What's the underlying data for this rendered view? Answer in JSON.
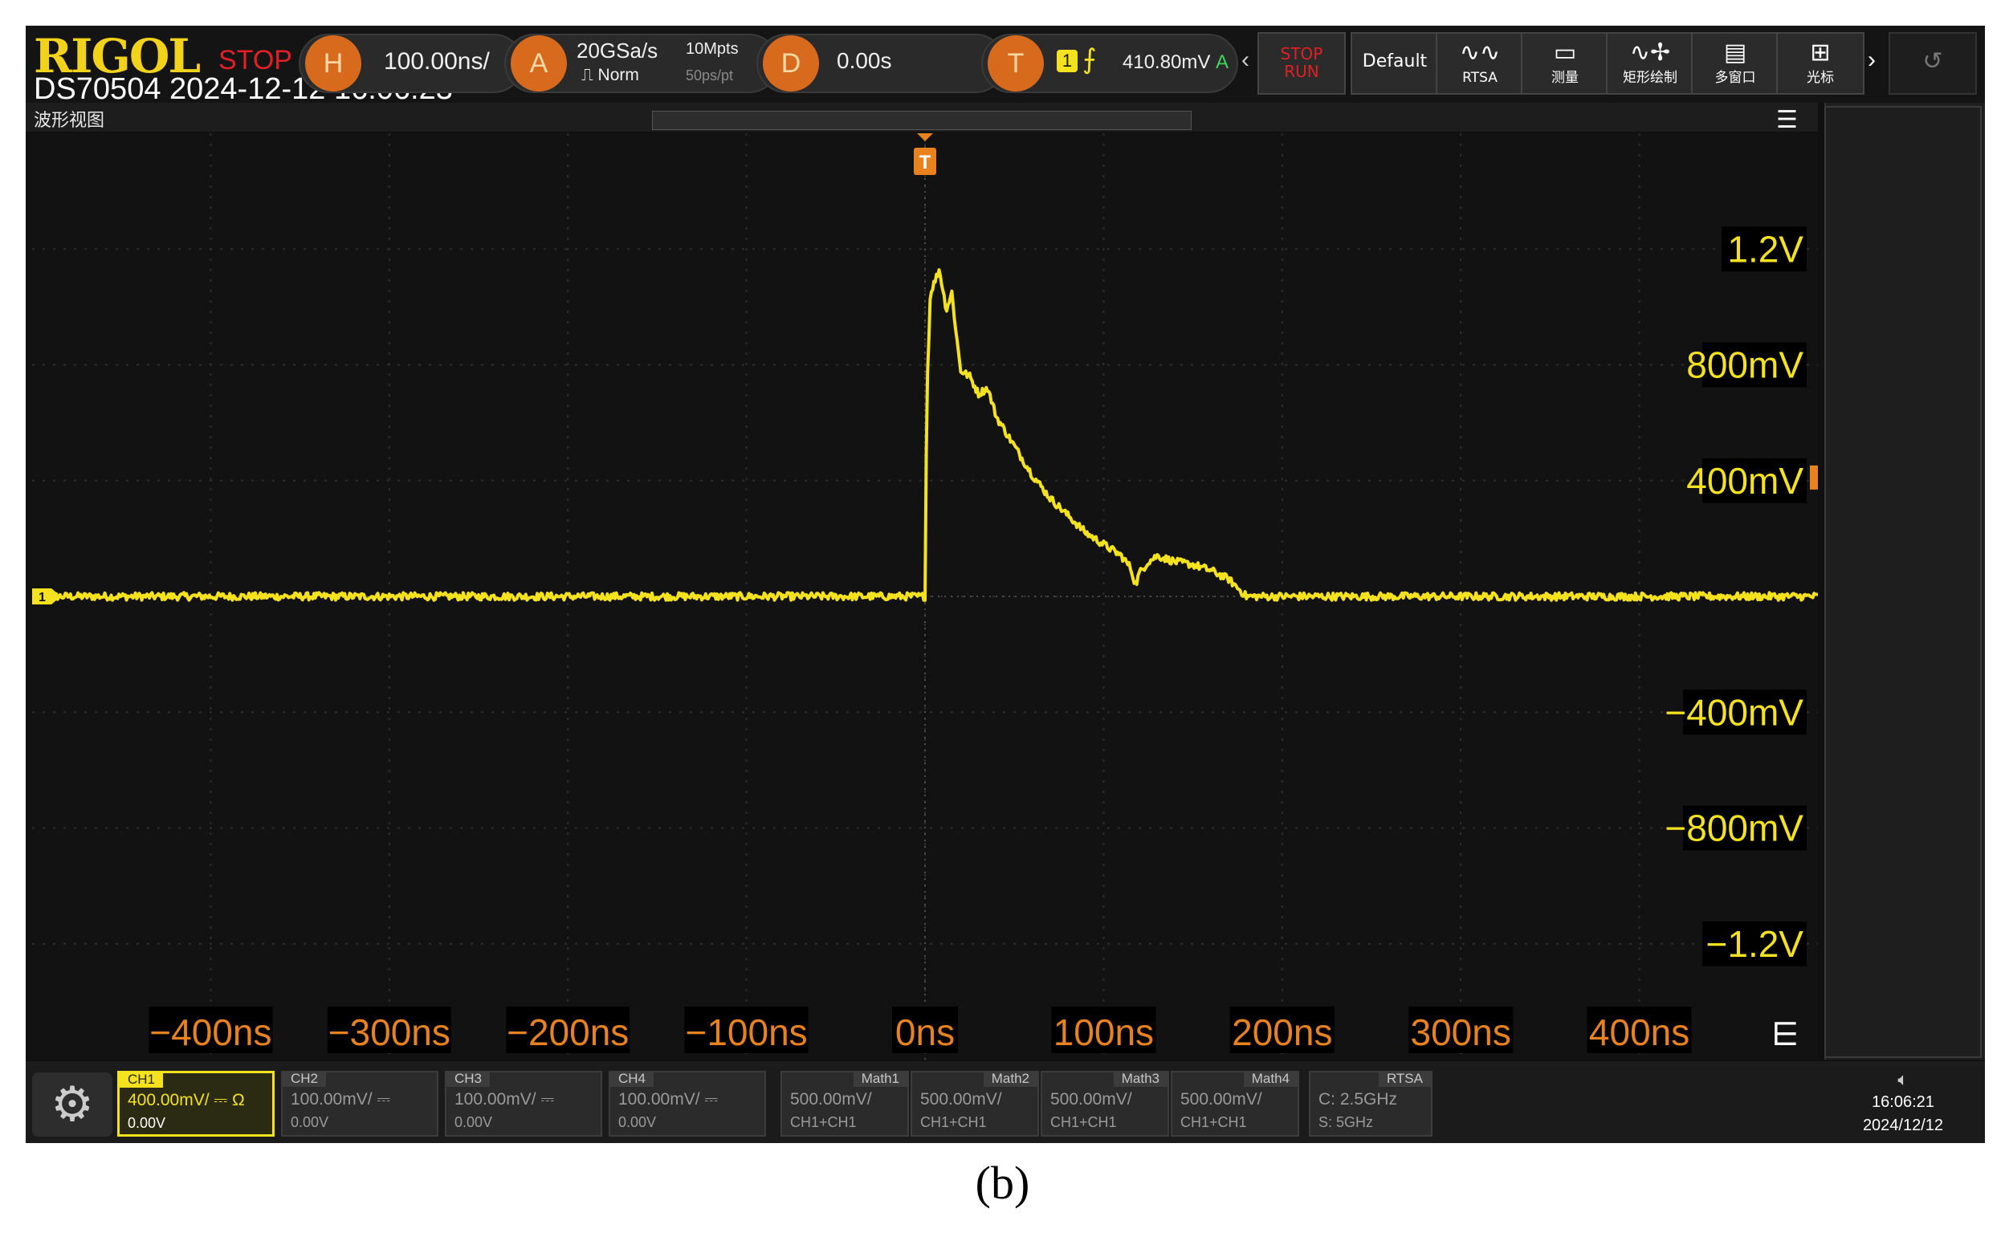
{
  "topbar": {
    "logo": "RIGOL",
    "run_state": "STOP",
    "device_info": "DS70504 2024-12-12 16:06:23",
    "horizontal": {
      "badge": "H",
      "scale": "100.00ns/"
    },
    "acquire": {
      "badge": "A",
      "rate": "20GSa/s",
      "mode": "Norm",
      "depth": "10Mpts",
      "resolution": "50ps/pt"
    },
    "delay": {
      "badge": "D",
      "value": "0.00s"
    },
    "trigger": {
      "badge": "T",
      "source": "1",
      "level": "410.80mV",
      "mode": "A"
    },
    "buttons": [
      {
        "name": "stop-run",
        "icon": "",
        "label_top": "STOP",
        "label_bottom": "RUN"
      },
      {
        "name": "default",
        "icon": "Default",
        "label_top": "",
        "label_bottom": ""
      },
      {
        "name": "rtsa",
        "icon": "∿∿",
        "label_top": "",
        "label_bottom": "RTSA"
      },
      {
        "name": "measure",
        "icon": "▭",
        "label_top": "",
        "label_bottom": "测量"
      },
      {
        "name": "zone-draw",
        "icon": "∿✢",
        "label_top": "",
        "label_bottom": "矩形绘制"
      },
      {
        "name": "multi-window",
        "icon": "▤",
        "label_top": "",
        "label_bottom": "多窗口"
      },
      {
        "name": "cursor",
        "icon": "⊞",
        "label_top": "",
        "label_bottom": "光标"
      }
    ]
  },
  "view": {
    "title": "波形视图",
    "trigger_marker": "T",
    "channel_marker": "1"
  },
  "chart_data": {
    "type": "line",
    "xlabel": "",
    "ylabel": "",
    "x_ticks": [
      "−400ns",
      "−300ns",
      "−200ns",
      "−100ns",
      "0ns",
      "100ns",
      "200ns",
      "300ns",
      "400ns"
    ],
    "y_ticks": [
      "1.2V",
      "800mV",
      "400mV",
      "−400mV",
      "−800mV",
      "−1.2V"
    ],
    "xlim_ns": [
      -500,
      500
    ],
    "ylim_mV": [
      -1600,
      1600
    ],
    "grid": true,
    "color": "#f5e21e",
    "series": [
      {
        "x_ns": [
          -500,
          0,
          1,
          3,
          5,
          8,
          10,
          12,
          15,
          18,
          20,
          25,
          30,
          35,
          40,
          50,
          60,
          70,
          80,
          90,
          100,
          110,
          115,
          118,
          120,
          125,
          130,
          140,
          150,
          160,
          170,
          175,
          180,
          500
        ],
        "y_mV": [
          0,
          0,
          700,
          1050,
          1080,
          1130,
          1060,
          990,
          1050,
          880,
          780,
          760,
          700,
          720,
          620,
          520,
          420,
          340,
          280,
          220,
          180,
          140,
          100,
          40,
          80,
          120,
          140,
          120,
          110,
          90,
          60,
          30,
          0,
          0
        ]
      }
    ]
  },
  "bottombar": {
    "channels": [
      {
        "tab": "CH1",
        "scale": "400.00mV/",
        "coupling": "⎓ Ω",
        "offset": "0.00V"
      },
      {
        "tab": "CH2",
        "scale": "100.00mV/",
        "coupling": "⎓",
        "offset": "0.00V"
      },
      {
        "tab": "CH3",
        "scale": "100.00mV/",
        "coupling": "⎓",
        "offset": "0.00V"
      },
      {
        "tab": "CH4",
        "scale": "100.00mV/",
        "coupling": "⎓",
        "offset": "0.00V"
      },
      {
        "tab": "Math1",
        "scale": "500.00mV/",
        "coupling": "",
        "offset": "CH1+CH1"
      },
      {
        "tab": "Math2",
        "scale": "500.00mV/",
        "coupling": "",
        "offset": "CH1+CH1"
      },
      {
        "tab": "Math3",
        "scale": "500.00mV/",
        "coupling": "",
        "offset": "CH1+CH1"
      },
      {
        "tab": "Math4",
        "scale": "500.00mV/",
        "coupling": "",
        "offset": "CH1+CH1"
      },
      {
        "tab": "RTSA",
        "scale": "C: 2.5GHz",
        "coupling": "",
        "offset": "S: 5GHz"
      }
    ],
    "time": "16:06:21",
    "date": "2024/12/12"
  },
  "caption": "(b)"
}
